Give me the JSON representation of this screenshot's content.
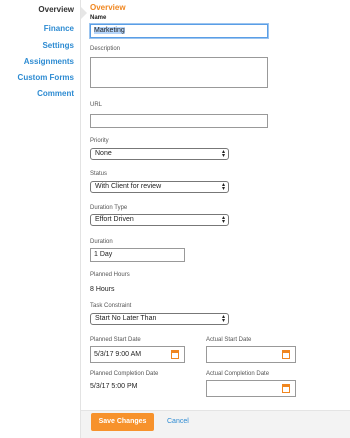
{
  "sidebar": {
    "items": [
      {
        "label": "Overview",
        "active": true
      },
      {
        "label": "Finance",
        "active": false
      },
      {
        "label": "Settings",
        "active": false
      },
      {
        "label": "Assignments",
        "active": false
      },
      {
        "label": "Custom Forms",
        "active": false
      },
      {
        "label": "Comment",
        "active": false
      }
    ]
  },
  "form": {
    "section_title": "Overview",
    "name": {
      "label": "Name",
      "value": "Marketing"
    },
    "description": {
      "label": "Description",
      "value": ""
    },
    "url": {
      "label": "URL",
      "value": ""
    },
    "priority": {
      "label": "Priority",
      "value": "None"
    },
    "status": {
      "label": "Status",
      "value": "With Client for review"
    },
    "duration_type": {
      "label": "Duration Type",
      "value": "Effort Driven"
    },
    "duration": {
      "label": "Duration",
      "value": "1 Day"
    },
    "planned_hours": {
      "label": "Planned Hours",
      "value": "8 Hours"
    },
    "task_constraint": {
      "label": "Task Constraint",
      "value": "Start No Later Than"
    },
    "planned_start": {
      "label": "Planned Start Date",
      "value": "5/3/17 9:00 AM"
    },
    "actual_start": {
      "label": "Actual Start Date",
      "value": ""
    },
    "planned_completion": {
      "label": "Planned Completion Date",
      "value": "5/3/17 5:00 PM"
    },
    "actual_completion": {
      "label": "Actual Completion Date",
      "value": ""
    }
  },
  "footer": {
    "save_label": "Save Changes",
    "cancel_label": "Cancel"
  },
  "colors": {
    "accent": "#f7922c",
    "link": "#2d8bd2"
  }
}
